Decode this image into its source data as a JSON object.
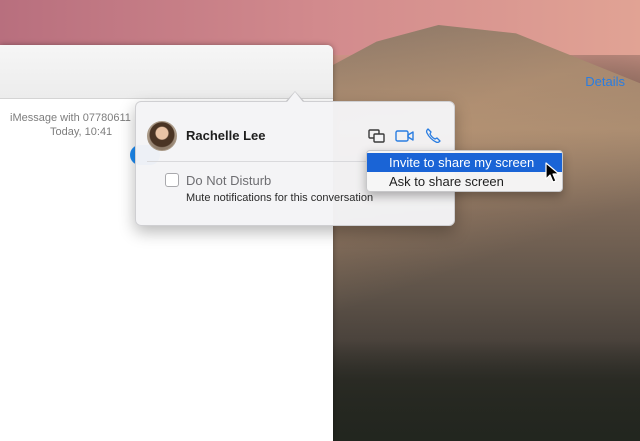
{
  "window": {
    "details_label": "Details",
    "conversation_line1": "iMessage with 07780611",
    "conversation_line2": "Today, 10:41"
  },
  "popover": {
    "contact_name": "Rachelle Lee",
    "actions": [
      {
        "icon": "screen-share-icon"
      },
      {
        "icon": "video-camera-icon"
      },
      {
        "icon": "phone-icon"
      }
    ],
    "do_not_disturb_label": "Do Not Disturb",
    "do_not_disturb_checked": false,
    "mute_note": "Mute notifications for this conversation"
  },
  "menu": {
    "items": [
      {
        "label": "Invite to share my screen",
        "selected": true
      },
      {
        "label": "Ask to share screen",
        "selected": false
      }
    ]
  },
  "colors": {
    "accent": "#2a7de1",
    "menu_highlight": "#1a64d6",
    "bubble": "#1d8cf4"
  }
}
